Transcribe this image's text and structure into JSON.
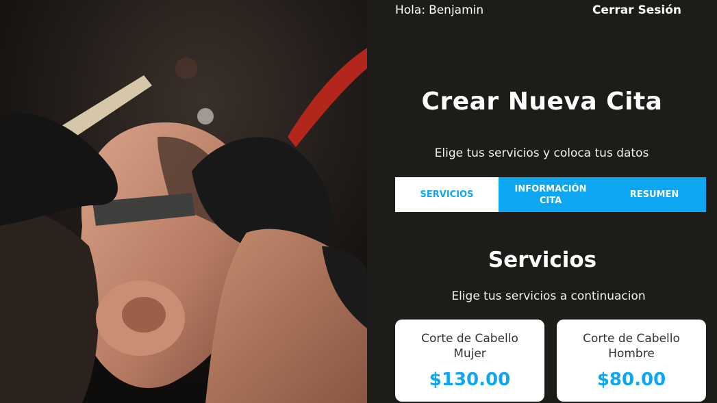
{
  "header": {
    "greeting_label": "Hola:",
    "user_name": "Benjamin",
    "logout_label": "Cerrar Sesión"
  },
  "main": {
    "title": "Crear Nueva Cita",
    "subtitle": "Elige tus servicios y coloca tus datos",
    "tabs": [
      {
        "label": "SERVICIOS",
        "active": true
      },
      {
        "label": "INFORMACIÓN CITA",
        "active": false
      },
      {
        "label": "RESUMEN",
        "active": false
      }
    ]
  },
  "services_section": {
    "title": "Servicios",
    "subtitle": "Elige tus servicios a continuacion",
    "services": [
      {
        "name": "Corte de Cabello Mujer",
        "price": "$130.00"
      },
      {
        "name": "Corte de Cabello Hombre",
        "price": "$80.00"
      }
    ]
  },
  "hero_image": {
    "description_icon": "barber-shaving-photo"
  },
  "colors": {
    "accent": "#0da6f3",
    "panel_bg": "#1d1c19",
    "card_bg": "#ffffff"
  }
}
